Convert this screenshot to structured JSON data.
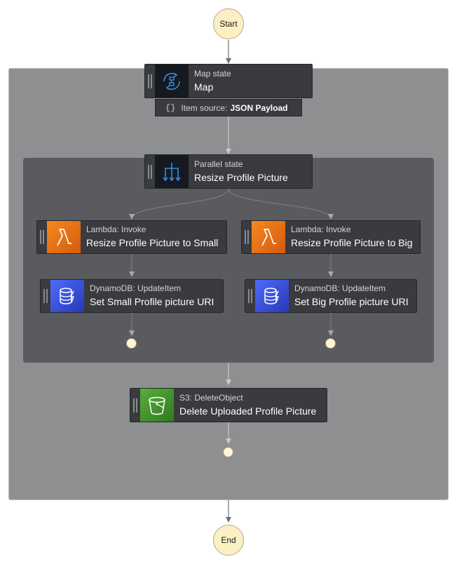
{
  "start": {
    "label": "Start"
  },
  "end": {
    "label": "End"
  },
  "map_state": {
    "type_label": "Map state",
    "name": "Map",
    "icon": "map-state-icon",
    "item_source": {
      "label": "Item source:",
      "value": "JSON Payload"
    }
  },
  "parallel_state": {
    "type_label": "Parallel state",
    "name": "Resize Profile Picture",
    "icon": "parallel-state-icon"
  },
  "branches": [
    {
      "lambda": {
        "type_label": "Lambda: Invoke",
        "name": "Resize Profile Picture to Small",
        "icon": "lambda-icon"
      },
      "dynamodb": {
        "type_label": "DynamoDB: UpdateItem",
        "name": "Set Small Profile picture URI",
        "icon": "dynamodb-icon"
      }
    },
    {
      "lambda": {
        "type_label": "Lambda: Invoke",
        "name": "Resize Profile Picture to Big",
        "icon": "lambda-icon"
      },
      "dynamodb": {
        "type_label": "DynamoDB: UpdateItem",
        "name": "Set Big Profile picture URI",
        "icon": "dynamodb-icon"
      }
    }
  ],
  "s3_delete": {
    "type_label": "S3: DeleteObject",
    "name": "Delete Uploaded Profile Picture",
    "icon": "s3-bucket-icon"
  },
  "colors": {
    "lambda": "#e8731a",
    "dynamodb": "#3b4fd8",
    "s3": "#3f8b2c",
    "terminal_fill": "#fbf0c4",
    "map_group": "#8e8f91",
    "parallel_group": "#5a5b5e",
    "node_fill": "#3a3b3e"
  }
}
